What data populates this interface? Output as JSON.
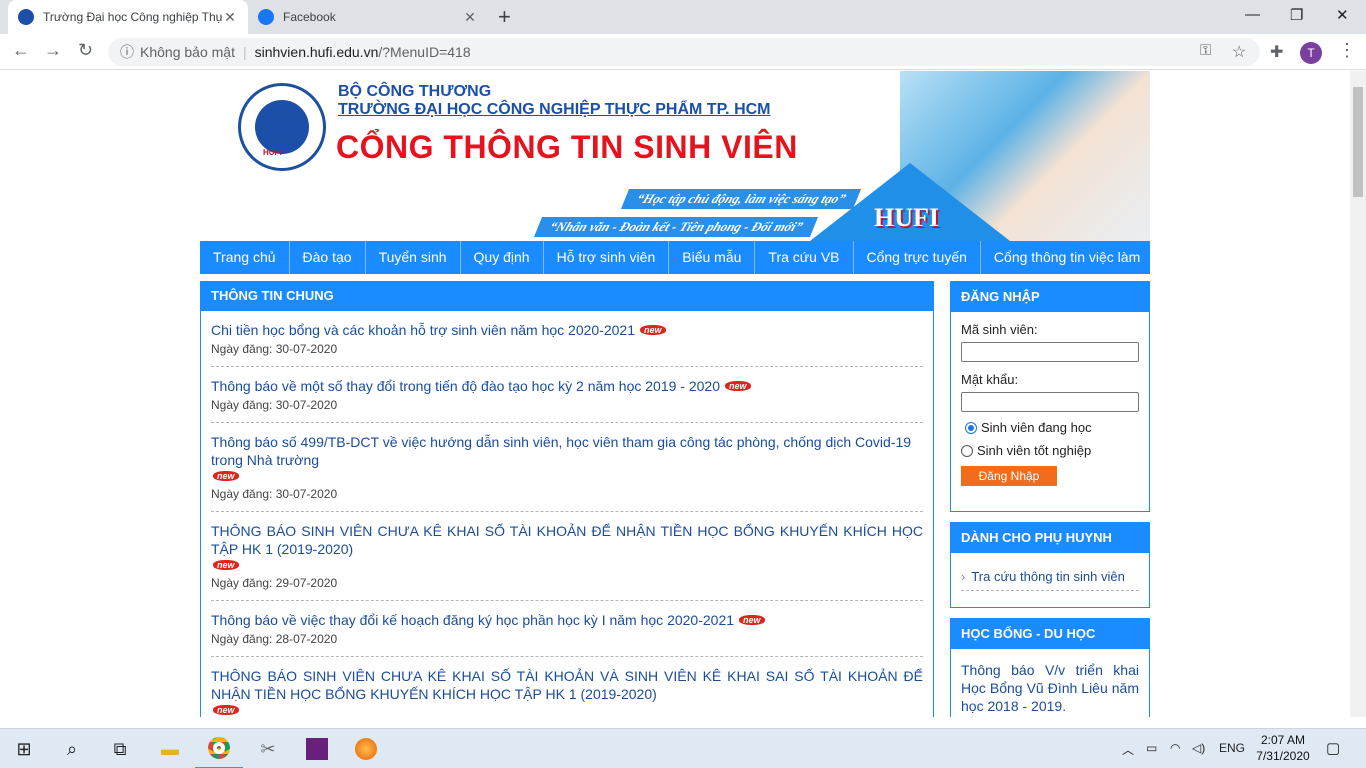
{
  "browser": {
    "tabs": [
      {
        "label": "Trường Đại học Công nghiệp Thự",
        "active": true
      },
      {
        "label": "Facebook",
        "active": false
      }
    ],
    "security_label": "Không bảo mật",
    "url_host": "sinhvien.hufi.edu.vn",
    "url_path": "/?MenuID=418",
    "profile_initial": "T"
  },
  "header": {
    "ministry": "BỘ CÔNG THƯƠNG",
    "university": "TRƯỜNG ĐẠI HỌC CÔNG NGHIỆP THỰC PHẨM TP. HCM",
    "portal_title": "CỔNG THÔNG TIN SINH VIÊN",
    "slogan_1": "“Học tập chủ động, làm việc sáng tạo”",
    "slogan_2": "“Nhân văn - Đoàn kết - Tiên phong - Đổi mới”",
    "brand": "HUFI",
    "logo_text": "HUFI"
  },
  "menu": [
    "Trang chủ",
    "Đào tạo",
    "Tuyển sinh",
    "Quy định",
    "Hỗ trợ sinh viên",
    "Biểu mẫu",
    "Tra cứu VB",
    "Cổng trực tuyến",
    "Cổng thông tin việc làm"
  ],
  "news": {
    "title": "THÔNG TIN CHUNG",
    "new_badge": "new",
    "date_prefix": "Ngày đăng:",
    "items": [
      {
        "title": "Chi tiền học bổng và các khoản hỗ trợ sinh viên năm học 2020-2021",
        "date": "30-07-2020"
      },
      {
        "title": "Thông báo về một số thay đổi trong tiến độ đào tạo học kỳ 2 năm học 2019 - 2020",
        "date": "30-07-2020"
      },
      {
        "title": "Thông báo số 499/TB-DCT về việc hướng dẫn sinh viên, học viên tham gia công tác phòng, chống dịch Covid-19 trong Nhà trường",
        "date": "30-07-2020"
      },
      {
        "title": "THÔNG BÁO SINH VIÊN CHƯA KÊ KHAI SỐ TÀI KHOẢN ĐỂ NHẬN TIỀN HỌC BỔNG KHUYẾN KHÍCH HỌC TẬP HK 1 (2019-2020)",
        "date": "29-07-2020"
      },
      {
        "title": "Thông báo về việc thay đổi kế hoạch đăng ký học phần học kỳ I năm học 2020-2021",
        "date": "28-07-2020"
      },
      {
        "title": "THÔNG BÁO SINH VIÊN CHƯA KÊ KHAI SỐ TÀI KHOẢN VÀ SINH VIÊN KÊ KHAI SAI SỐ TÀI KHOẢN ĐỂ NHẬN TIỀN HỌC BỔNG KHUYẾN KHÍCH HỌC TẬP HK 1 (2019-2020)",
        "date": ""
      }
    ]
  },
  "login": {
    "title": "ĐĂNG NHẬP",
    "student_id_label": "Mã sinh viên:",
    "password_label": "Mật khẩu:",
    "radio_current": "Sinh viên đang học",
    "radio_graduated": "Sinh viên tốt nghiệp",
    "button": "Đăng Nhập"
  },
  "parents": {
    "title": "DÀNH CHO PHỤ HUYNH",
    "link": "Tra cứu thông tin sinh viên"
  },
  "scholarship": {
    "title": "HỌC BỔNG - DU HỌC",
    "text": "Thông báo V/v triển khai Học Bổng Vũ Đình Liêu năm học 2018 - 2019."
  },
  "taskbar": {
    "language": "ENG",
    "time": "2:07 AM",
    "date": "7/31/2020"
  },
  "colors": {
    "accent": "#1a8cff",
    "title_red": "#e5131d",
    "link_blue": "#1a4c9c",
    "login_orange": "#f36c1c"
  }
}
